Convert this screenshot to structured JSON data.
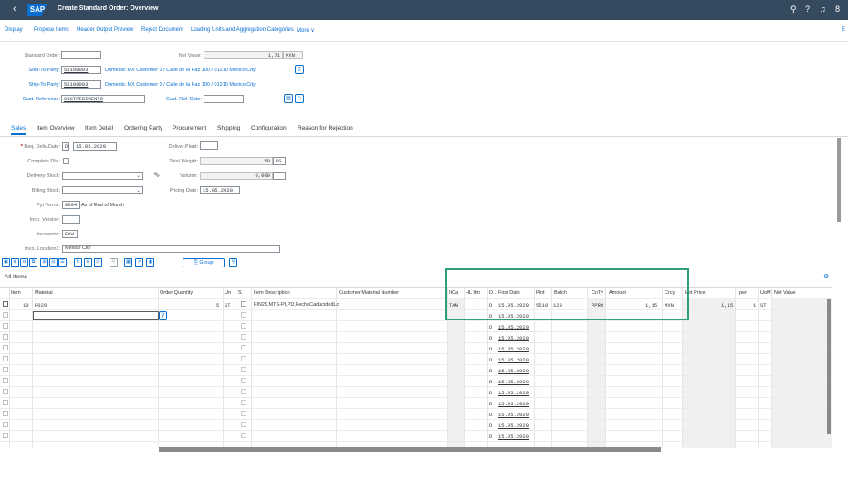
{
  "shell": {
    "back_icon": "back-icon",
    "logo": "SAP",
    "title": "Create Standard Order: Overview",
    "icons": [
      "search-icon",
      "help-icon",
      "bell-icon",
      "user-icon"
    ],
    "user_initial": "8"
  },
  "toolbar": {
    "items": [
      "Display",
      "Propose Items",
      "Header Output Preview",
      "Reject Document",
      "Loading Units and Aggregation Categories",
      "More"
    ],
    "more_suffix": "∨",
    "exit": "E"
  },
  "header": {
    "standard_order_label": "Standard Order:",
    "standard_order_value": "",
    "net_value_label": "Net Value:",
    "net_value": "1,71",
    "currency": "MXN",
    "sold_to_label": "Sold-To Party:",
    "sold_to_value": "55100003",
    "sold_to_desc": "Domestic MX Customer 3 / Calle de la Paz 100 / 01210 Mexico City",
    "ship_to_label": "Ship-To Party:",
    "ship_to_value": "55100003",
    "ship_to_desc": "Domestic MX Customer 3 / Calle de la Paz 100 / 01210 Mexico City",
    "cust_ref_label": "Cust. Reference:",
    "cust_ref_value": "CUSTPEDIMENTO",
    "cust_ref_date_label": "Cust. Ref. Date:",
    "cust_ref_date_value": ""
  },
  "tabs": [
    "Sales",
    "Item Overview",
    "Item Detail",
    "Ordering Party",
    "Procurement",
    "Shipping",
    "Configuration",
    "Reason for Rejection"
  ],
  "sales": {
    "req_deliv_date_label": "Req. Deliv.Date:",
    "req_deliv_date_type": "D",
    "req_deliv_date": "15.05.2020",
    "deliver_plant_label": "Deliver.Plant:",
    "deliver_plant": "",
    "complete_dlv_label": "Complete Dlv.:",
    "total_weight_label": "Total Weight:",
    "total_weight": "50",
    "weight_unit": "KG",
    "delivery_block_label": "Delivery Block:",
    "volume_label": "Volume:",
    "volume": "0,000",
    "volume_unit": "",
    "billing_block_label": "Billing Block:",
    "pricing_date_label": "Pricing Date:",
    "pricing_date": "15.05.2020",
    "pyt_terms_label": "Pyt Terms:",
    "pyt_terms": "0004",
    "pyt_terms_desc": "As of End of Month",
    "inco_version_label": "Inco. Version:",
    "inco_version": "",
    "incoterms_label": "Incoterms:",
    "incoterms": "EXW",
    "inco_location_label": "Inco. Location1:",
    "inco_location": "Mexico City"
  },
  "item_toolbar": {
    "group_label": "Group",
    "all_items": "All Items"
  },
  "grid": {
    "headers": [
      "Item",
      "Material",
      "Order Quantity",
      "Un",
      "S",
      "Item Description",
      "Customer Material Number",
      "ItCa",
      "HL Itm",
      "D..",
      "First Date",
      "Plnt",
      "Batch",
      "CnTy",
      "Amount",
      "Crcy",
      "Net Price",
      "per",
      "UoM",
      "Net Value"
    ],
    "row1": {
      "item": "10",
      "material": "F029",
      "qty": "5",
      "un": "ST",
      "desc": "FIN29,MTS-PI,PD,FechaCaducidadLc",
      "itca": "TAN",
      "d": "D",
      "first_date": "15.05.2020",
      "plnt": "5510",
      "batch": "123",
      "cnty": "PPR0",
      "amount": "1,15",
      "crcy": "MXN",
      "net_price": "1,15",
      "per": "1",
      "uom": "ST"
    },
    "empty_row_d": "D",
    "empty_row_date": "15.05.2020"
  }
}
